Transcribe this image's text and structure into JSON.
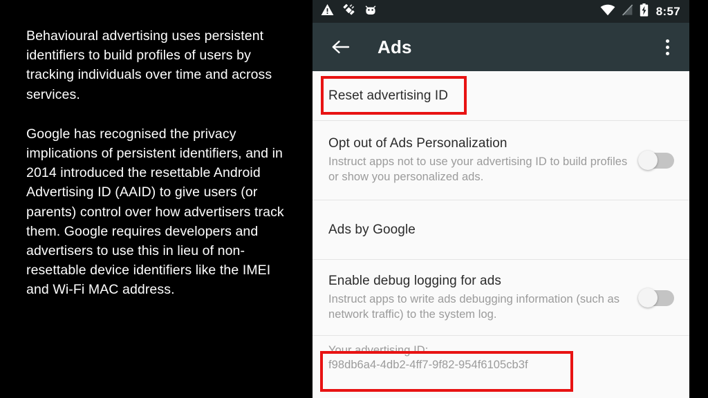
{
  "slide": {
    "paragraphs": [
      "Behavioural advertising uses persistent identifiers to build profiles of users by tracking individuals over time and across services.",
      "Google has recognised the privacy implications of persistent identifiers, and in 2014 introduced the resettable Android Advertising ID (AAID) to give users (or parents) control over how advertisers track them. Google requires developers and advertisers to use this in lieu of non-resettable device identifiers like the IMEI and Wi-Fi MAC address."
    ]
  },
  "phone": {
    "status_bar": {
      "clock": "8:57",
      "left_icons": [
        "warning-triangle-icon",
        "gps-satellite-icon",
        "android-bug-icon"
      ],
      "right_icons": [
        "wifi-icon",
        "no-signal-icon",
        "battery-charging-icon"
      ],
      "background": "#1d2426"
    },
    "app_bar": {
      "back_label": "back-arrow-icon",
      "title": "Ads",
      "overflow_label": "overflow-menu-icon",
      "background": "#2c393d"
    },
    "settings": [
      {
        "id": "reset-advertising-id",
        "title": "Reset advertising ID",
        "summary": "",
        "has_switch": false,
        "switch_state": ""
      },
      {
        "id": "opt-out-ads-personalization",
        "title": "Opt out of Ads Personalization",
        "summary": "Instruct apps not to use your advertising ID to build profiles or show you personalized ads.",
        "has_switch": true,
        "switch_state": "off"
      },
      {
        "id": "ads-by-google",
        "title": "Ads by Google",
        "summary": "",
        "has_switch": false,
        "switch_state": ""
      },
      {
        "id": "enable-debug-logging-for-ads",
        "title": "Enable debug logging for ads",
        "summary": "Instruct apps to write ads debugging information (such as network traffic) to the system log.",
        "has_switch": true,
        "switch_state": "off"
      }
    ],
    "advertising_id": {
      "label": "Your advertising ID:",
      "value": "f98db6a4-4db2-4ff7-9f82-954f6105cb3f"
    },
    "annotations": {
      "color": "#e81313",
      "targets": [
        "reset-advertising-id",
        "advertising-id-value"
      ]
    }
  }
}
